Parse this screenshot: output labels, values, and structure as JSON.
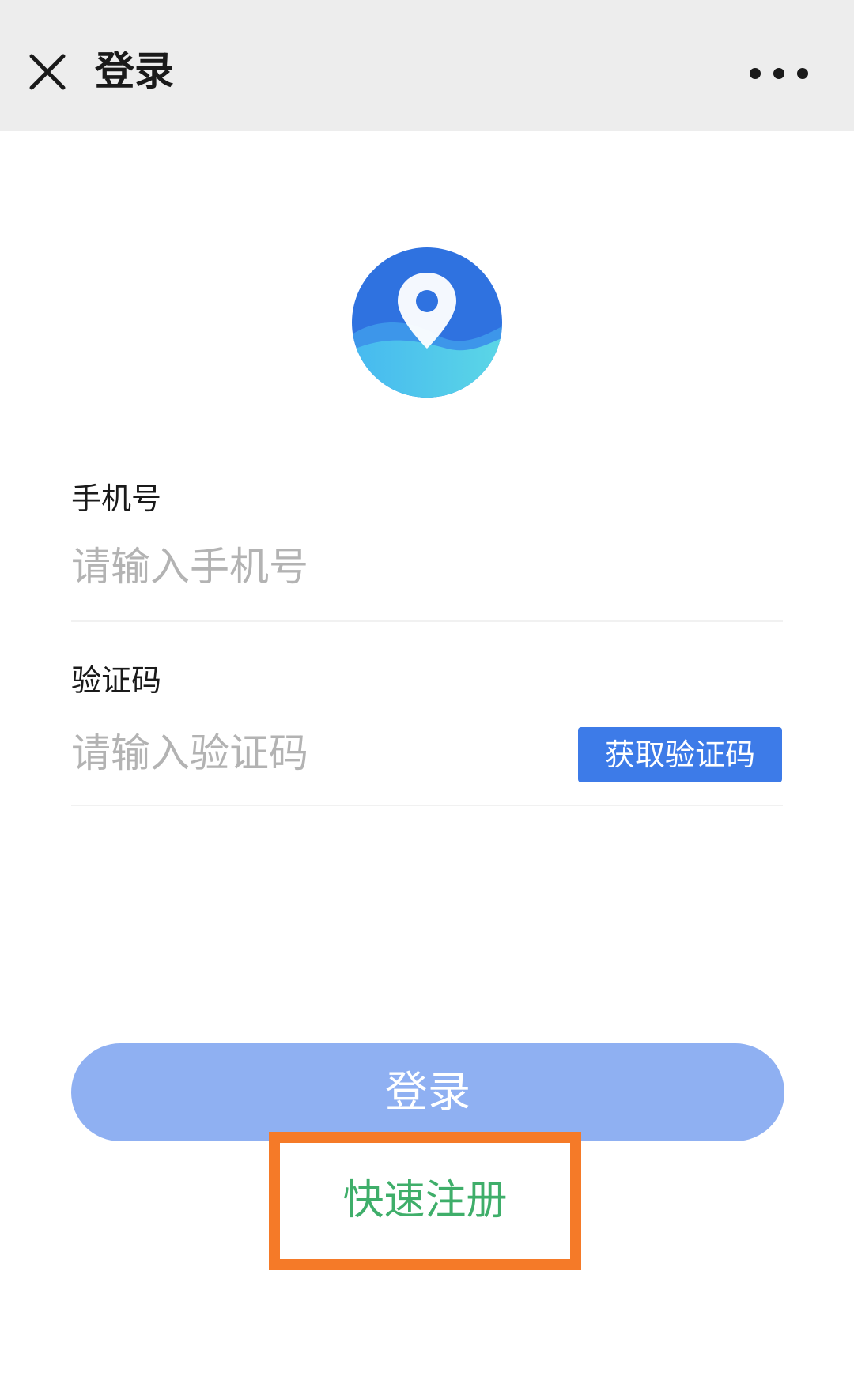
{
  "header": {
    "title": "登录",
    "close_icon": "close-icon",
    "more_icon": "more-icon"
  },
  "logo": {
    "icon": "location-pin-logo-icon"
  },
  "phone": {
    "label": "手机号",
    "placeholder": "请输入手机号",
    "value": ""
  },
  "code": {
    "label": "验证码",
    "placeholder": "请输入验证码",
    "value": "",
    "get_code_label": "获取验证码"
  },
  "actions": {
    "login_label": "登录",
    "register_label": "快速注册"
  },
  "colors": {
    "header_bg": "#ededed",
    "accent_blue": "#3d7be8",
    "login_button": "#8fb0f2",
    "register_green": "#3fae6a",
    "highlight_orange": "#f57a28"
  }
}
